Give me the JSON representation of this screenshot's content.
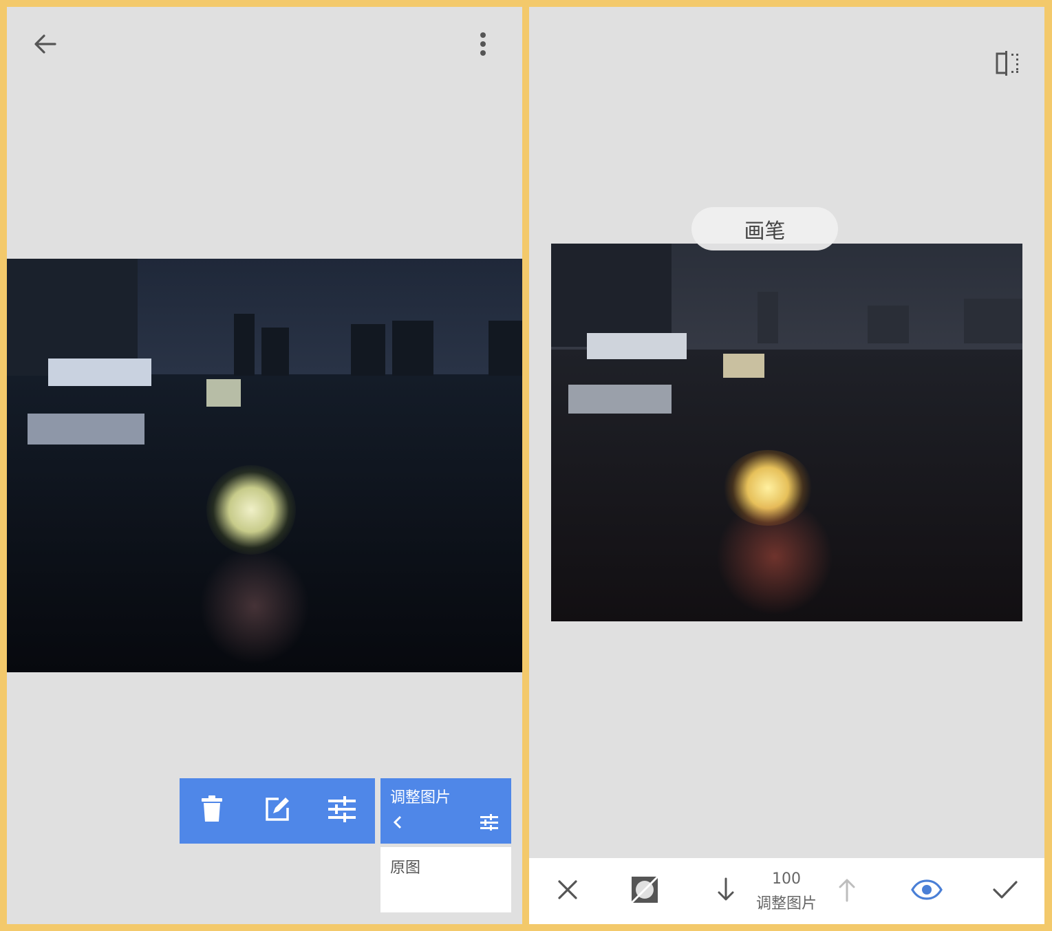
{
  "left": {
    "toolbar": {
      "back_icon": "back-arrow-icon",
      "menu_icon": "more-vert-icon"
    },
    "actions": {
      "delete_icon": "trash-icon",
      "edit_icon": "edit-square-icon",
      "adjust_icon": "sliders-icon"
    },
    "adjust_card": {
      "title": "调整图片",
      "chevron_icon": "chevron-left-icon",
      "sliders_icon": "sliders-icon"
    },
    "original_item": {
      "label": "原图"
    }
  },
  "right": {
    "toolbar": {
      "compare_icon": "compare-icon"
    },
    "brush_label": "画笔",
    "bottom_bar": {
      "cancel_icon": "close-icon",
      "invert_icon": "mask-invert-icon",
      "decrease_icon": "arrow-down-icon",
      "value": "100",
      "effect_name": "调整图片",
      "increase_icon": "arrow-up-icon",
      "view_icon": "eye-icon",
      "confirm_icon": "check-icon"
    }
  },
  "colors": {
    "frame": "#f3c96b",
    "panel_bg": "#e0e0e0",
    "accent": "#4f87e8",
    "eye_active": "#4a7fd6",
    "icon_gray": "#555555"
  }
}
